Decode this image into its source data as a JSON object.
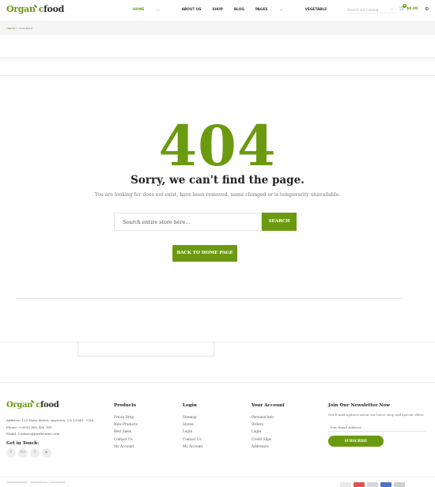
{
  "header": {
    "logo_left": "Organ",
    "logo_mid": "c",
    "logo_right": "food",
    "nav": [
      "HOME",
      "ABOUT US",
      "SHOP",
      "BLOG",
      "PAGES",
      "VEGETABLE"
    ],
    "search_placeholder": "Search our catalog",
    "cart_count": "0",
    "cart_total": "$0.00"
  },
  "breadcrumb": {
    "home": "Home",
    "separator": "»",
    "current": "checkout"
  },
  "error": {
    "code": "404",
    "title": "Sorry, we can't find the page.",
    "message": "You are looking for does not exist, have been removed, name changed or is temporarity unavailable.",
    "search_placeholder": "Search entire store here...",
    "search_button": "SEARCH",
    "home_button": "BACK TO HOME PAGE"
  },
  "footer": {
    "logo_left": "Organ",
    "logo_mid": "c",
    "logo_right": "food",
    "address": "Address: 123 Main Street, Anytown, CA 12345 - USA.",
    "phone": "Phone: +(000) 800 456 789",
    "email": "Email: Contact@posthemes.com",
    "get_in_touch": "Get in Touch:",
    "social_icons": [
      "twitter-icon",
      "google-plus-icon",
      "facebook-icon",
      "youtube-icon"
    ],
    "columns": [
      {
        "title": "Products",
        "items": [
          "Prices Drop",
          "New Products",
          "Best Sales",
          "Contact Us",
          "My Account"
        ]
      },
      {
        "title": "Login",
        "items": [
          "Sitemap",
          "Stores",
          "Login",
          "Contact Us",
          "My Account"
        ]
      },
      {
        "title": "Your Account",
        "items": [
          "Personal Info",
          "Orders",
          "Login",
          "Credit Slips",
          "Addresses"
        ]
      }
    ],
    "newsletter": {
      "title": "Join Our Newsletter Now",
      "text": "Get E-mail updates about our latest shop and special offers.",
      "placeholder": "Your Email Address",
      "button": "SUBSCRIBE"
    }
  },
  "colors": {
    "accent": "#6b9a10"
  }
}
